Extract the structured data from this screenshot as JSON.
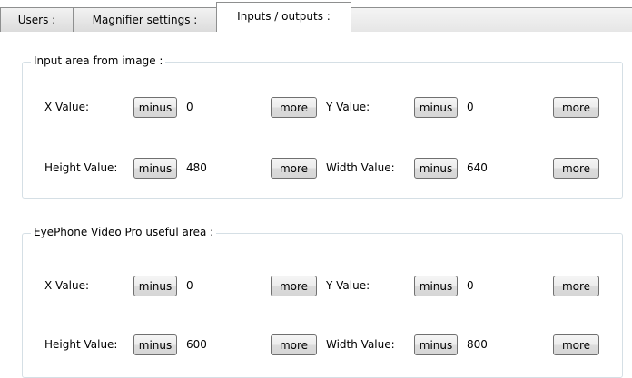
{
  "tabs": [
    {
      "label": "Users :"
    },
    {
      "label": "Magnifier settings :"
    },
    {
      "label": "Inputs / outputs :"
    }
  ],
  "button_labels": {
    "decrease": "minus",
    "increase": "more"
  },
  "groups": [
    {
      "title": "Input area from image :",
      "fields": {
        "x": {
          "label": "X Value:",
          "value": "0"
        },
        "y": {
          "label": "Y Value:",
          "value": "0"
        },
        "height": {
          "label": "Height Value:",
          "value": "480"
        },
        "width": {
          "label": "Width Value:",
          "value": "640"
        }
      }
    },
    {
      "title": "EyePhone Video Pro useful area :",
      "fields": {
        "x": {
          "label": "X Value:",
          "value": "0"
        },
        "y": {
          "label": "Y Value:",
          "value": "0"
        },
        "height": {
          "label": "Height Value:",
          "value": "600"
        },
        "width": {
          "label": "Width Value:",
          "value": "800"
        }
      }
    }
  ]
}
